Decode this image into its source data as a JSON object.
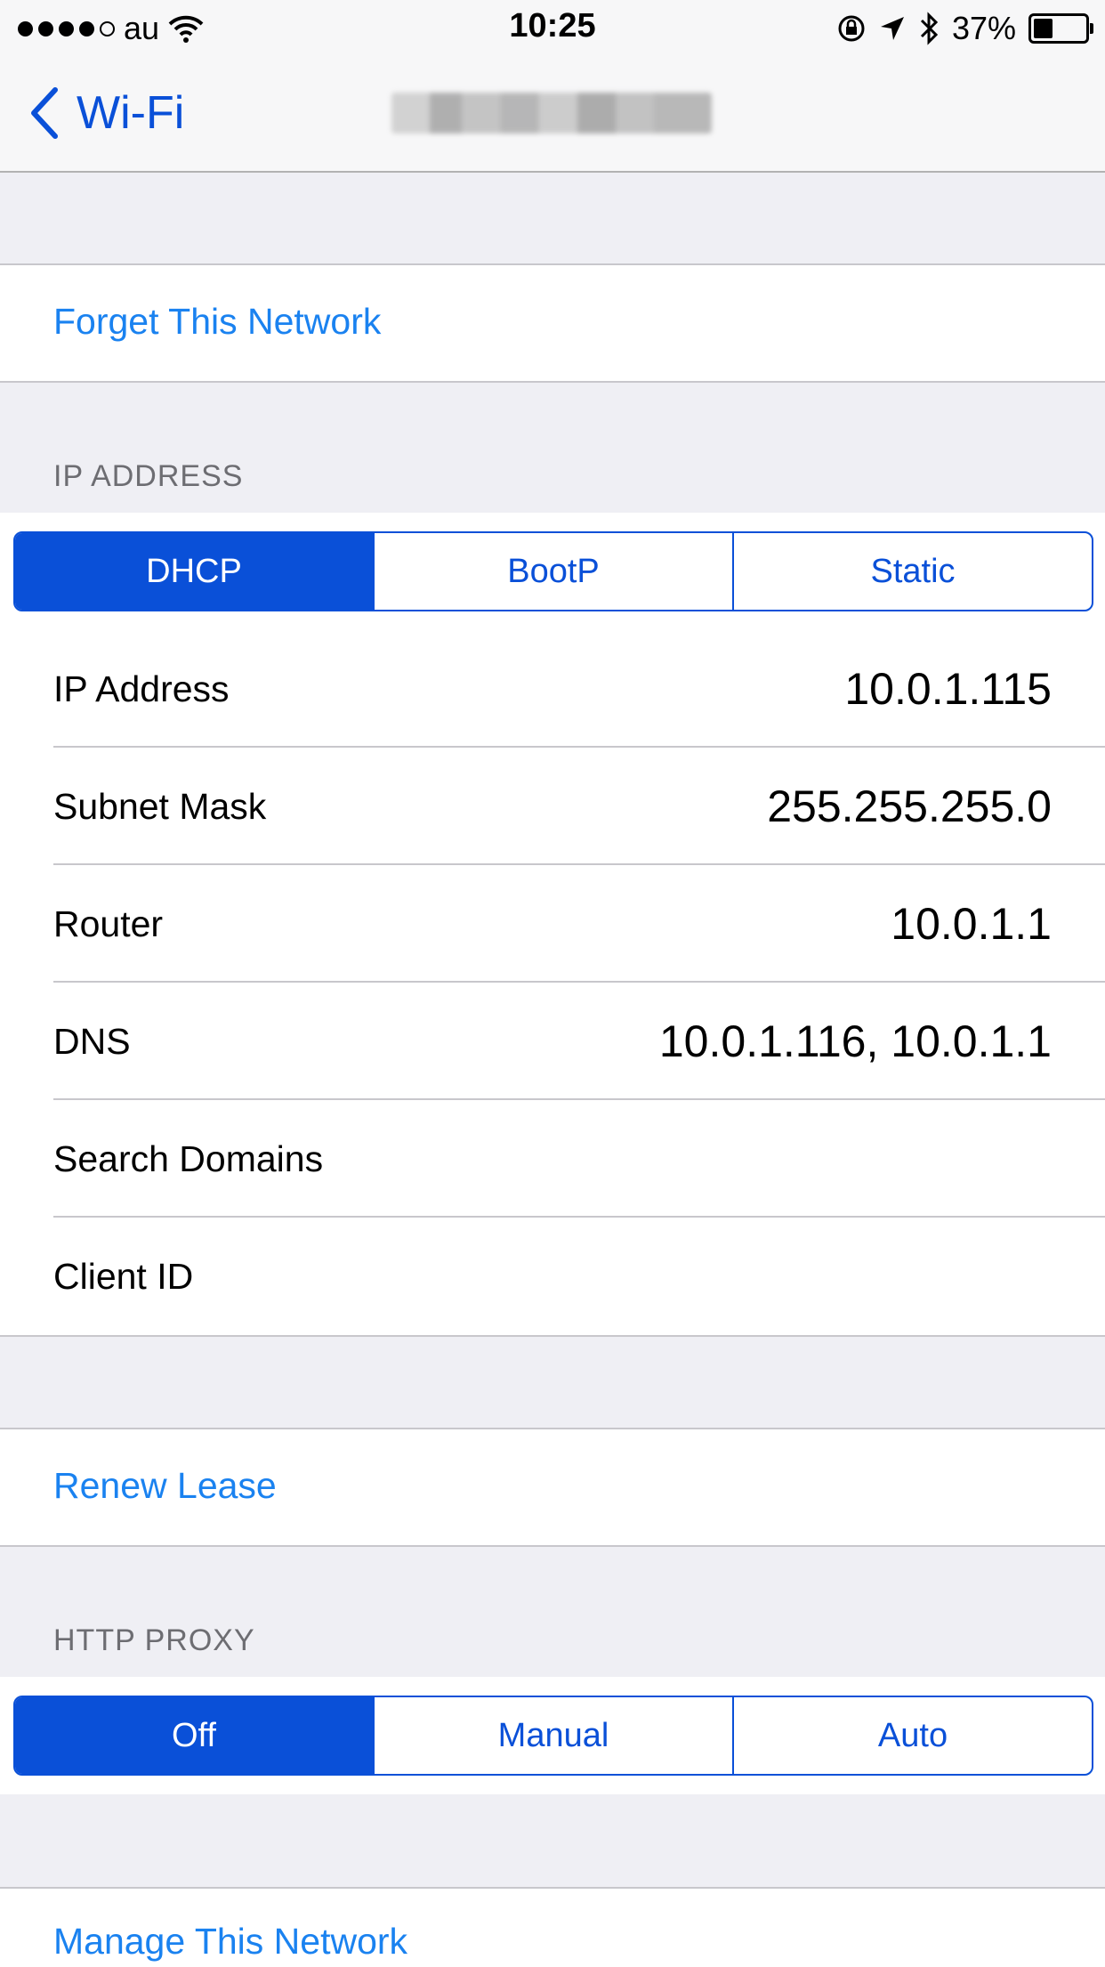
{
  "status_bar": {
    "carrier": "au",
    "time": "10:25",
    "battery_percent": "37%",
    "battery_level": 0.37
  },
  "nav": {
    "back_label": "Wi-Fi"
  },
  "forget_network": "Forget This Network",
  "ip_section": {
    "header": "IP ADDRESS",
    "segments": [
      "DHCP",
      "BootP",
      "Static"
    ],
    "selected": "DHCP",
    "rows": [
      {
        "label": "IP Address",
        "value": "10.0.1.115"
      },
      {
        "label": "Subnet Mask",
        "value": "255.255.255.0"
      },
      {
        "label": "Router",
        "value": "10.0.1.1"
      },
      {
        "label": "DNS",
        "value": "10.0.1.116, 10.0.1.1"
      },
      {
        "label": "Search Domains",
        "value": ""
      },
      {
        "label": "Client ID",
        "value": ""
      }
    ]
  },
  "renew_lease": "Renew Lease",
  "proxy_section": {
    "header": "HTTP PROXY",
    "segments": [
      "Off",
      "Manual",
      "Auto"
    ],
    "selected": "Off"
  },
  "manage_network": "Manage This Network",
  "colors": {
    "accent": "#0a50d8",
    "link": "#1a82f0",
    "background": "#efeff4"
  }
}
